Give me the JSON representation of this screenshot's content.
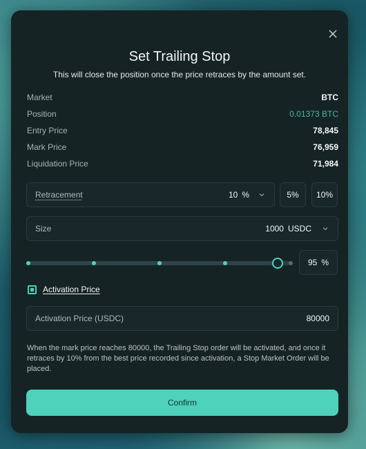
{
  "modal": {
    "title": "Set Trailing Stop",
    "subtitle": "This will close the position once the price retraces by the amount set."
  },
  "info": [
    {
      "label": "Market",
      "value": "BTC"
    },
    {
      "label": "Position",
      "value": "0.01373 BTC"
    },
    {
      "label": "Entry Price",
      "value": "78,845"
    },
    {
      "label": "Mark Price",
      "value": "76,959"
    },
    {
      "label": "Liquidation Price",
      "value": "71,984"
    }
  ],
  "retracement": {
    "label": "Retracement",
    "value": "10",
    "unit": "%",
    "quick_options": [
      "5%",
      "10%"
    ]
  },
  "size": {
    "label": "Size",
    "value": "1000",
    "unit": "USDC"
  },
  "slider": {
    "percent": 95,
    "value_label": "95",
    "unit": "%",
    "marks": [
      0,
      25,
      50,
      75,
      100
    ]
  },
  "activation": {
    "checkbox_label": "Activation Price",
    "checked": true,
    "field_label": "Activation Price (USDC)",
    "field_value": "80000"
  },
  "note": "When the mark price reaches 80000, the Trailing Stop order will be activated, and once it retraces by 10% from the best price recorded since activation, a Stop Market Order will be placed.",
  "confirm_label": "Confirm",
  "colors": {
    "accent": "#4fd2bc",
    "position_value": "#3fbf9f",
    "modal_bg": "#162325"
  },
  "icons": {
    "close": "close-icon",
    "dropdown": "chevron-down-icon"
  }
}
